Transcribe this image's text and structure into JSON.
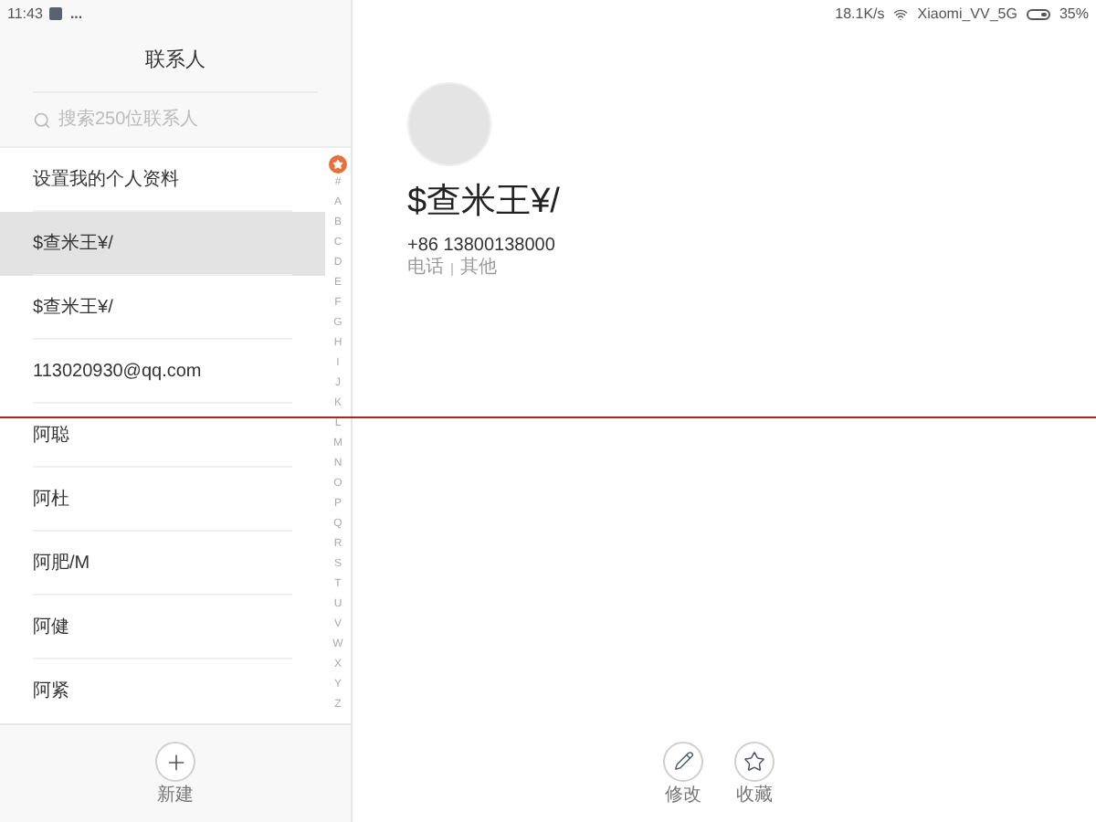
{
  "status_bar": {
    "time": "11:43",
    "more": "...",
    "speed": "18.1K/s",
    "network": "Xiaomi_VV_5G",
    "battery": "35%"
  },
  "sidebar": {
    "title": "联系人",
    "search": {
      "placeholder": "搜索250位联系人"
    },
    "contacts": [
      {
        "name": "设置我的个人资料",
        "selected": false
      },
      {
        "name": "$查米王¥/",
        "selected": true
      },
      {
        "name": "$查米王¥/",
        "selected": false
      },
      {
        "name": "113020930@qq.com",
        "selected": false
      },
      {
        "name": "阿聪",
        "selected": false
      },
      {
        "name": "阿杜",
        "selected": false
      },
      {
        "name": "阿肥/M",
        "selected": false
      },
      {
        "name": "阿健",
        "selected": false
      },
      {
        "name": "阿紧",
        "selected": false
      }
    ],
    "index": [
      "#",
      "A",
      "B",
      "C",
      "D",
      "E",
      "F",
      "G",
      "H",
      "I",
      "J",
      "K",
      "L",
      "M",
      "N",
      "O",
      "P",
      "Q",
      "R",
      "S",
      "T",
      "U",
      "V",
      "W",
      "X",
      "Y",
      "Z"
    ],
    "new_button": {
      "label": "新建"
    }
  },
  "detail": {
    "name": "$查米王¥/",
    "phone": "+86 13800138000",
    "phone_type": "电话",
    "phone_group": "其他",
    "actions": [
      {
        "kind": "edit",
        "label": "修改"
      },
      {
        "kind": "favorite",
        "label": "收藏"
      }
    ]
  }
}
